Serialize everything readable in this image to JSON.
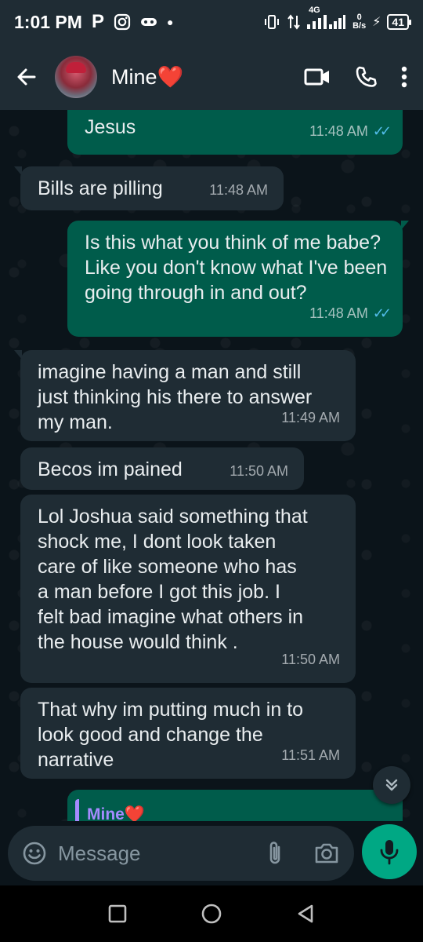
{
  "status_bar": {
    "time": "1:01 PM",
    "network_label": "4G",
    "speed_value": "0",
    "speed_unit": "B/s",
    "battery": "41"
  },
  "header": {
    "contact_name": "Mine❤️"
  },
  "messages": [
    {
      "dir": "out",
      "text": "Jesus",
      "time": "11:48 AM",
      "read": true
    },
    {
      "dir": "in",
      "text": "Bills are pilling",
      "time": "11:48 AM"
    },
    {
      "dir": "out",
      "text": "Is this what you think of me babe? Like you don't know what I've been going through in and out?",
      "time": "11:48 AM",
      "read": true
    },
    {
      "dir": "in",
      "text": "imagine having a man and still just thinking his there to answer my man.",
      "time": "11:49 AM"
    },
    {
      "dir": "in",
      "text": "Becos im pained",
      "time": "11:50 AM"
    },
    {
      "dir": "in",
      "text": "Lol Joshua said something that shock me, I dont look taken care of like someone who has a man before I got this job. I felt bad imagine what others in the house would think .",
      "time": "11:50 AM"
    },
    {
      "dir": "in",
      "text": "That why im putting much in to look good and change the narrative",
      "time": "11:51 AM"
    }
  ],
  "reply_preview": {
    "name": "Mine❤️"
  },
  "composer": {
    "placeholder": "Message"
  },
  "colors": {
    "chat_bg": "#0b141a",
    "bar_bg": "#1f2c34",
    "incoming_bubble": "#1f2c34",
    "outgoing_bubble": "#005c4b",
    "accent_green": "#00a884",
    "read_ticks": "#53bdeb"
  },
  "icons": [
    "back-arrow-icon",
    "video-call-icon",
    "phone-icon",
    "more-vert-icon",
    "emoji-icon",
    "attach-icon",
    "camera-icon",
    "mic-icon",
    "chevrons-down-icon",
    "nav-square-icon",
    "nav-circle-icon",
    "nav-triangle-icon"
  ]
}
